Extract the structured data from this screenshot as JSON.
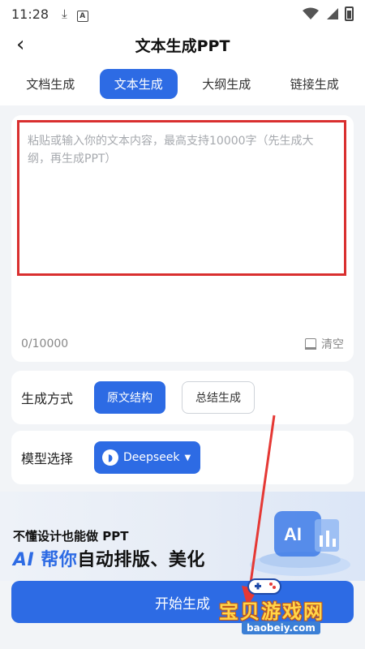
{
  "status": {
    "time": "11:28"
  },
  "header": {
    "title": "文本生成PPT"
  },
  "tabs": [
    {
      "label": "文档生成"
    },
    {
      "label": "文本生成"
    },
    {
      "label": "大纲生成"
    },
    {
      "label": "链接生成"
    }
  ],
  "editor": {
    "placeholder": "粘贴或输入你的文本内容，最高支持10000字（先生成大纲，再生成PPT）",
    "counter": "0/10000",
    "clear_label": "清空"
  },
  "generation_mode": {
    "label": "生成方式",
    "options": [
      {
        "label": "原文结构"
      },
      {
        "label": "总结生成"
      }
    ],
    "selected": "原文结构"
  },
  "model": {
    "label": "模型选择",
    "value": "Deepseek"
  },
  "banner": {
    "line1": "不懂设计也能做 PPT",
    "line2_ai": "AI",
    "line2_highlight": "帮你",
    "line2_rest": "自动排版、美化"
  },
  "start_button": {
    "label": "开始生成"
  },
  "watermark": {
    "text": "宝贝游戏网",
    "url": "baobeiy.com"
  },
  "colors": {
    "accent": "#2d6be4",
    "highlight_border": "#d92f2f",
    "annotation_arrow": "#e53935"
  }
}
